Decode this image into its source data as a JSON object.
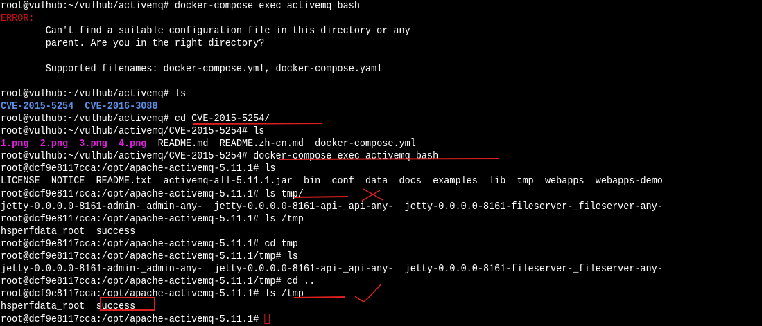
{
  "lines": [
    {
      "text": "root@vulhub:~/vulhub/activemq# docker-compose exec activemq bash"
    },
    {
      "text": "ERROR:",
      "cls": "err"
    },
    {
      "text": "        Can't find a suitable configuration file in this directory or any"
    },
    {
      "text": "        parent. Are you in the right directory?"
    },
    {
      "text": ""
    },
    {
      "text": "        Supported filenames: docker-compose.yml, docker-compose.yaml"
    },
    {
      "text": ""
    },
    {
      "text": "root@vulhub:~/vulhub/activemq# ls"
    },
    {
      "text": "CVE-2015-5254  CVE-2016-3088",
      "cls": "dir"
    },
    {
      "text": "root@vulhub:~/vulhub/activemq# cd CVE-2015-5254/"
    },
    {
      "text": "root@vulhub:~/vulhub/activemq/CVE-2015-5254# ls"
    },
    {
      "parts": [
        {
          "text": "1.png  2.png  3.png  4.png",
          "cls": "img"
        },
        {
          "text": "  README.md  README.zh-cn.md  docker-compose.yml"
        }
      ]
    },
    {
      "text": "root@vulhub:~/vulhub/activemq/CVE-2015-5254# docker-compose exec activemq bash"
    },
    {
      "text": "root@dcf9e8117cca:/opt/apache-activemq-5.11.1# ls"
    },
    {
      "text": "LICENSE  NOTICE  README.txt  activemq-all-5.11.1.jar  bin  conf  data  docs  examples  lib  tmp  webapps  webapps-demo"
    },
    {
      "text": "root@dcf9e8117cca:/opt/apache-activemq-5.11.1# ls tmp/"
    },
    {
      "text": "jetty-0.0.0.0-8161-admin-_admin-any-  jetty-0.0.0.0-8161-api-_api-any-  jetty-0.0.0.0-8161-fileserver-_fileserver-any-"
    },
    {
      "text": "root@dcf9e8117cca:/opt/apache-activemq-5.11.1# ls /tmp"
    },
    {
      "text": "hsperfdata_root  success"
    },
    {
      "text": "root@dcf9e8117cca:/opt/apache-activemq-5.11.1# cd tmp"
    },
    {
      "text": "root@dcf9e8117cca:/opt/apache-activemq-5.11.1/tmp# ls"
    },
    {
      "text": "jetty-0.0.0.0-8161-admin-_admin-any-  jetty-0.0.0.0-8161-api-_api-any-  jetty-0.0.0.0-8161-fileserver-_fileserver-any-"
    },
    {
      "text": "root@dcf9e8117cca:/opt/apache-activemq-5.11.1/tmp# cd .."
    },
    {
      "text": "root@dcf9e8117cca:/opt/apache-activemq-5.11.1# ls /tmp"
    },
    {
      "text": "hsperfdata_root  success"
    },
    {
      "text": "root@dcf9e8117cca:/opt/apache-activemq-5.11.1# ",
      "cursor": true
    }
  ],
  "colors": {
    "background": "#000000",
    "text": "#ffffff",
    "error": "#d01010",
    "directory": "#5b8fe6",
    "image_file": "#e020e0",
    "annotation": "#e02020"
  }
}
